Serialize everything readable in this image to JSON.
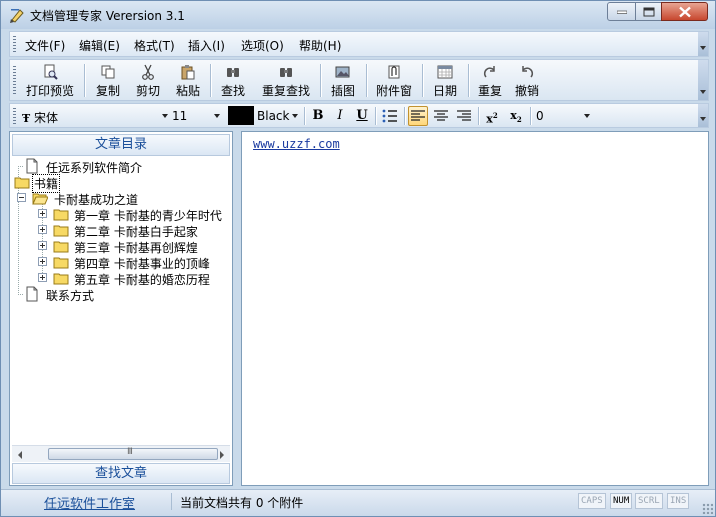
{
  "window": {
    "title": "文档管理专家 Verersion 3.1"
  },
  "menu": [
    {
      "label": "文件(F)"
    },
    {
      "label": "编辑(E)"
    },
    {
      "label": "格式(T)"
    },
    {
      "label": "插入(I)"
    },
    {
      "label": "选项(O)"
    },
    {
      "label": "帮助(H)"
    }
  ],
  "toolbar": {
    "print_preview": "打印预览",
    "copy": "复制",
    "cut": "剪切",
    "paste": "粘贴",
    "find": "查找",
    "find_again": "重复查找",
    "insert_image": "插图",
    "attachments": "附件窗",
    "date": "日期",
    "redo": "重复",
    "undo": "撤销"
  },
  "format": {
    "font_name": "宋体",
    "font_size": "11",
    "color_name": "Black",
    "color_value": "#000000",
    "bold": "B",
    "italic": "I",
    "underline": "U",
    "spacing": "0"
  },
  "left_panel": {
    "header": "文章目录",
    "footer": "查找文章",
    "tree": {
      "intro": "任远系列软件简介",
      "books": "书籍",
      "carnegie": "卡耐基成功之道",
      "chapters": [
        "第一章 卡耐基的青少年时代",
        "第二章 卡耐基白手起家",
        "第三章 卡耐基再创辉煌",
        "第四章  卡耐基事业的顶峰",
        "第五章  卡耐基的婚恋历程"
      ],
      "contact": "联系方式"
    }
  },
  "editor": {
    "content": "www.uzzf.com"
  },
  "statusbar": {
    "link": "任远软件工作室",
    "attachments_text": "当前文档共有 0 个附件",
    "indicators": [
      {
        "label": "CAPS",
        "active": false
      },
      {
        "label": "NUM",
        "active": true
      },
      {
        "label": "SCRL",
        "active": false
      },
      {
        "label": "INS",
        "active": false
      }
    ]
  }
}
